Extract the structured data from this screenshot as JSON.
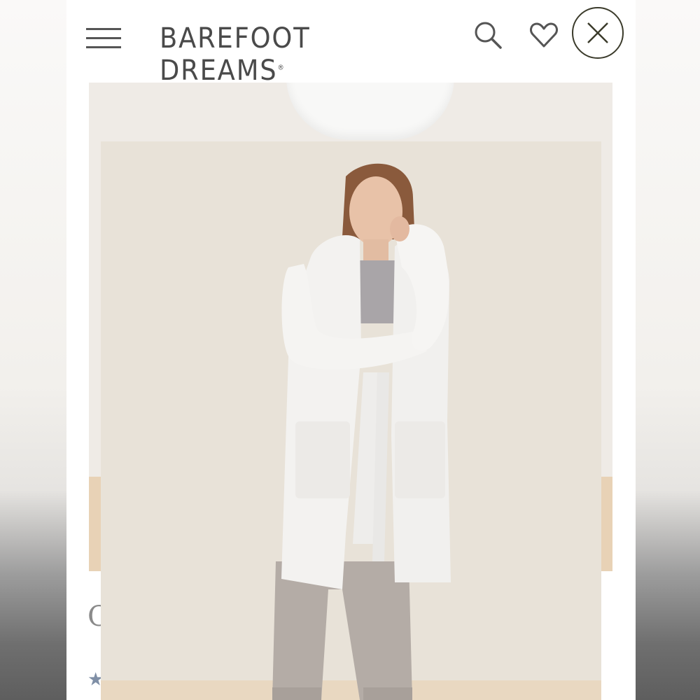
{
  "header": {
    "brand": "BAREFOOT DREAMS",
    "registered_mark": "®",
    "menu_icon": "hamburger-menu-icon",
    "search_icon": "search-icon",
    "favorite_icon": "heart-icon",
    "close_icon": "close-icon"
  },
  "peek": {
    "title_initial": "C",
    "rating_star": "★"
  },
  "product_photo": {
    "subject": "model wearing hooded cozy robe",
    "background_color": "#e8e2d8",
    "robe_color": "#f3f2f0"
  }
}
